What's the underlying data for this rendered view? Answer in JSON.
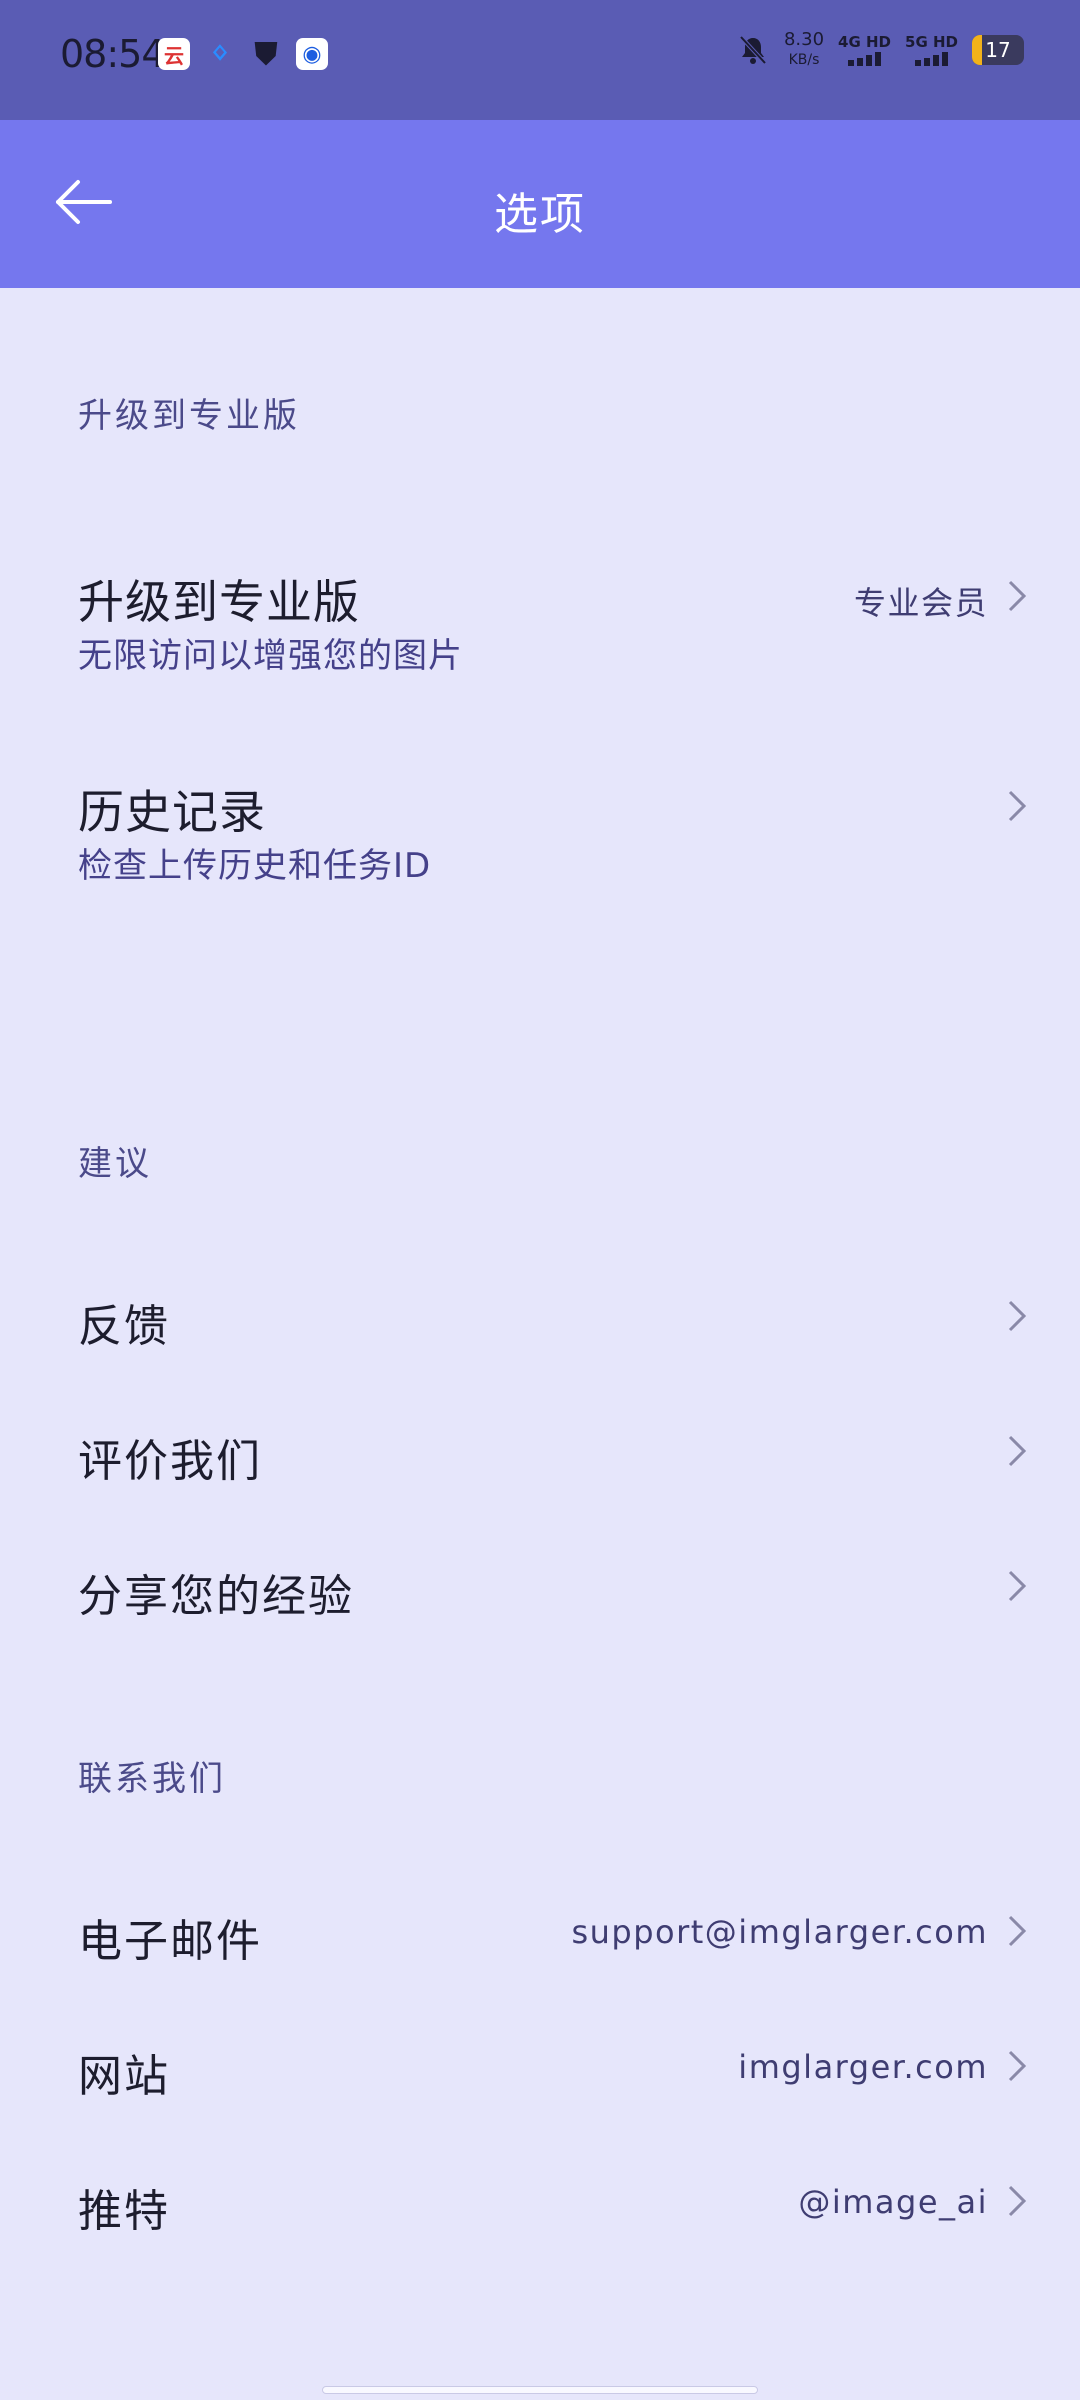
{
  "status_bar": {
    "time": "08:54",
    "net_speed_value": "8.30",
    "net_speed_unit": "KB/s",
    "sim1": "4G HD",
    "sim2": "5G HD",
    "battery": "17"
  },
  "app_bar": {
    "title": "选项"
  },
  "sections": {
    "upgrade": {
      "header": "升级到专业版",
      "items": [
        {
          "title": "升级到专业版",
          "subtitle": "无限访问以增强您的图片",
          "value": "专业会员"
        },
        {
          "title": "历史记录",
          "subtitle": "检查上传历史和任务ID"
        }
      ]
    },
    "suggestions": {
      "header": "建议",
      "items": [
        {
          "title": "反馈"
        },
        {
          "title": "评价我们"
        },
        {
          "title": "分享您的经验"
        }
      ]
    },
    "contact": {
      "header": "联系我们",
      "items": [
        {
          "title": "电子邮件",
          "value": "support@imglarger.com"
        },
        {
          "title": "网站",
          "value": "imglarger.com"
        },
        {
          "title": "推特",
          "value": "@image_ai"
        }
      ]
    }
  },
  "colors": {
    "status_bar_bg": "#5a5cb4",
    "app_bar_bg": "#7577ee",
    "page_bg": "#e6e6fb",
    "accent_text": "#4b4a8a"
  }
}
